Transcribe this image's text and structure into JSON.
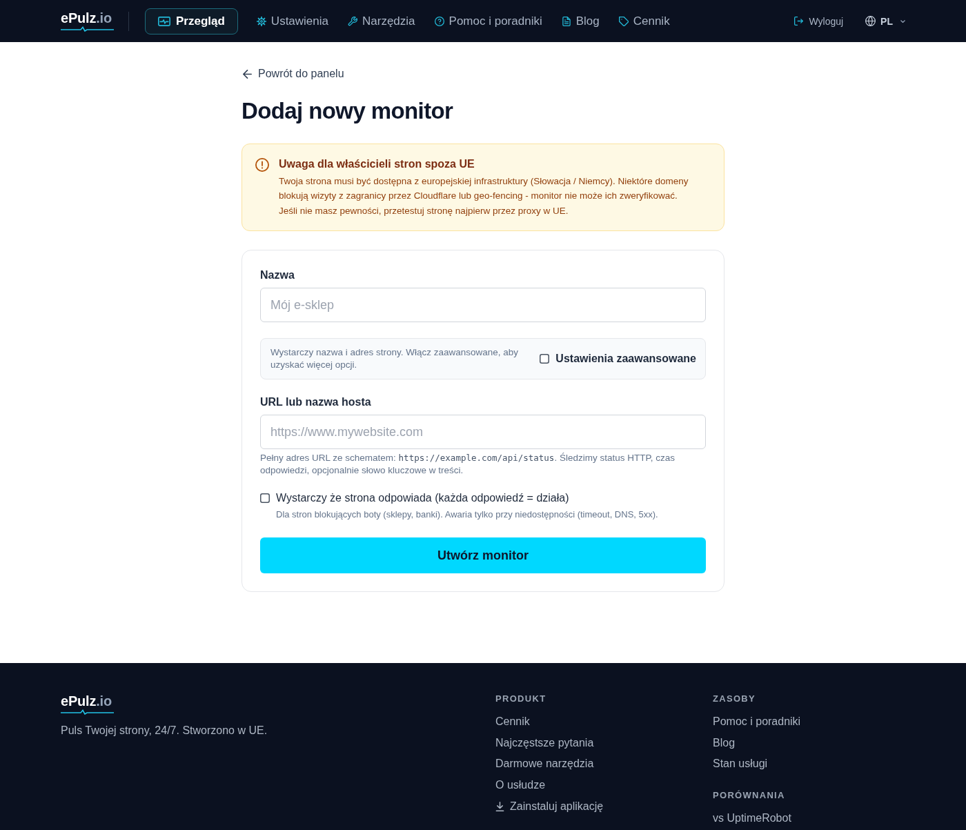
{
  "header": {
    "logo": {
      "name": "ePulz",
      "suffix": ".io"
    },
    "nav": [
      {
        "label": "Przegląd",
        "selected": true
      },
      {
        "label": "Ustawienia",
        "selected": false
      },
      {
        "label": "Narzędzia",
        "selected": false
      },
      {
        "label": "Pomoc i poradniki",
        "selected": false
      },
      {
        "label": "Blog",
        "selected": false
      },
      {
        "label": "Cennik",
        "selected": false
      }
    ],
    "logout": "Wyloguj",
    "language": "PL"
  },
  "back_link": "Powrót do panelu",
  "title": "Dodaj nowy monitor",
  "notice": {
    "title": "Uwaga dla właścicieli stron spoza UE",
    "text": "Twoja strona musi być dostępna z europejskiej infrastruktury (Słowacja / Niemcy). Niektóre domeny blokują wizyty z zagranicy przez Cloudflare lub geo-fencing - monitor nie może ich zweryfikować. Jeśli nie masz pewności, przetestuj stronę najpierw przez proxy w UE."
  },
  "form": {
    "name_field": {
      "label": "Nazwa",
      "placeholder": "Mój e-sklep"
    },
    "advanced": {
      "text": "Wystarczy nazwa i adres strony. Włącz zaawansowane, aby uzyskać więcej opcji.",
      "label": "Ustawienia zaawansowane",
      "checked": false
    },
    "url_field": {
      "label": "URL lub nazwa hosta",
      "placeholder": "https://www.mywebsite.com",
      "hint": [
        {
          "kind": "text",
          "text": "Pełny adres URL ze schematem: "
        },
        {
          "kind": "code",
          "text": "https://example.com/api/status"
        },
        {
          "kind": "text",
          "text": ". Śledzimy status HTTP, czas odpowiedzi, opcjonalnie słowo kluczowe w treści."
        }
      ]
    },
    "any_response": {
      "label": "Wystarczy że strona odpowiada (każda odpowiedź = działa)",
      "hint": "Dla stron blokujących boty (sklepy, banki). Awaria tylko przy niedostępności (timeout, DNS, 5xx).",
      "checked": false
    },
    "submit": "Utwórz monitor"
  },
  "footer": {
    "logo": {
      "name": "ePulz",
      "suffix": ".io"
    },
    "tagline": "Puls Twojej strony, 24/7. Stworzono w UE.",
    "columns": [
      [
        {
          "heading": "PRODUKT",
          "links": [
            {
              "kind": "link",
              "label": "Cennik"
            },
            {
              "kind": "link",
              "label": "Najczęstsze pytania"
            },
            {
              "kind": "link",
              "label": "Darmowe narzędzia"
            },
            {
              "kind": "link",
              "label": "O usłudze"
            },
            {
              "kind": "install",
              "label": "Zainstaluj aplikację"
            }
          ]
        }
      ],
      [
        {
          "heading": "ZASOBY",
          "links": [
            {
              "kind": "link",
              "label": "Pomoc i poradniki"
            },
            {
              "kind": "link",
              "label": "Blog"
            },
            {
              "kind": "link",
              "label": "Stan usługi"
            }
          ]
        },
        {
          "heading": "PORÓWNANIA",
          "links": [
            {
              "kind": "link",
              "label": "vs UptimeRobot"
            }
          ]
        }
      ]
    ]
  }
}
